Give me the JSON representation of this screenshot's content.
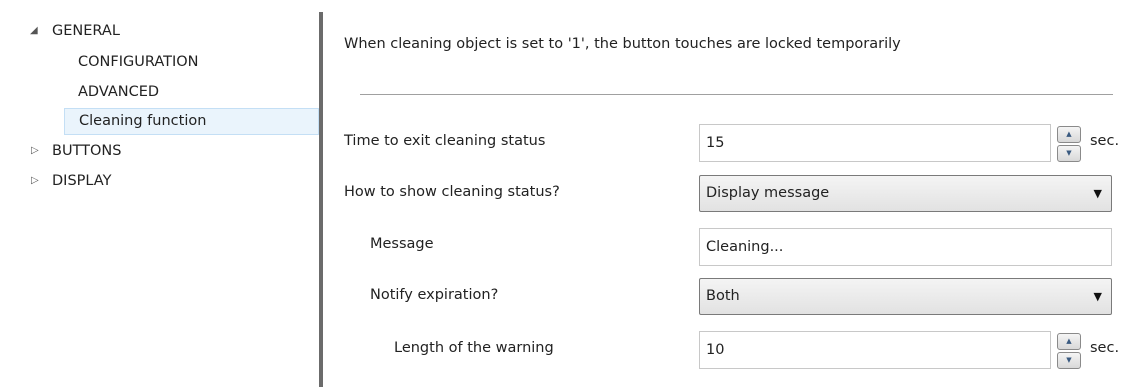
{
  "sidebar": {
    "items": [
      {
        "label": "GENERAL",
        "arrow": "◢"
      },
      {
        "label": "CONFIGURATION"
      },
      {
        "label": "ADVANCED"
      },
      {
        "label": "Cleaning function"
      },
      {
        "label": "BUTTONS",
        "arrow": "▷"
      },
      {
        "label": "DISPLAY",
        "arrow": "▷"
      }
    ],
    "selected_index": 3
  },
  "main": {
    "description": "When cleaning object is set to '1', the button touches are locked temporarily",
    "params": {
      "time_exit": {
        "label": "Time to exit cleaning status",
        "value": "15",
        "unit": "sec."
      },
      "show_status": {
        "label": "How to show cleaning status?",
        "value": "Display message"
      },
      "message": {
        "label": "Message",
        "value": "Cleaning..."
      },
      "notify": {
        "label": "Notify expiration?",
        "value": "Both"
      },
      "warning_length": {
        "label": "Length of the warning",
        "value": "10",
        "unit": "sec."
      }
    }
  },
  "icons": {
    "spin_up": "▲",
    "spin_down": "▼",
    "dropdown": "▼"
  },
  "colors": {
    "selected_bg": "#eaf4fc",
    "selected_border": "#c4dff5",
    "divider": "#6b6b6b"
  }
}
